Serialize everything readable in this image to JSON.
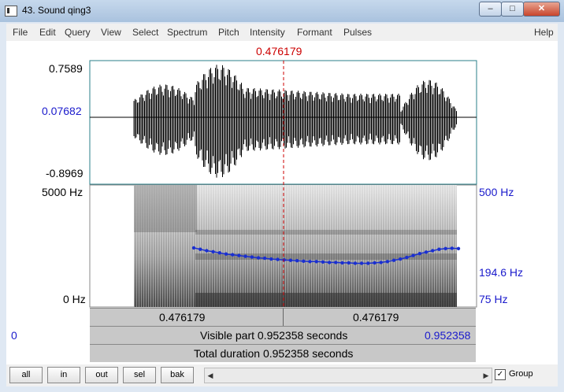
{
  "window": {
    "title": "43. Sound qing3"
  },
  "title_buttons": {
    "minimize": "–",
    "maximize": "□",
    "close": "✕"
  },
  "menu": [
    "File",
    "Edit",
    "Query",
    "View",
    "Select",
    "Spectrum",
    "Pitch",
    "Intensity",
    "Formant",
    "Pulses",
    "Help"
  ],
  "cursor_time": "0.476179",
  "waveform": {
    "max_label": "0.7589",
    "cursor_value": "0.07682",
    "min_label": "-0.8969"
  },
  "spectrogram": {
    "top_freq": "5000 Hz",
    "bottom_freq": "0 Hz",
    "pitch_top": "500 Hz",
    "pitch_value": "194.6 Hz",
    "pitch_bottom": "75 Hz"
  },
  "time_bar": {
    "left": "0.476179",
    "right": "0.476179"
  },
  "visible_bar": {
    "start": "0",
    "text": "Visible part 0.952358 seconds",
    "end": "0.952358"
  },
  "total_bar": {
    "text": "Total duration 0.952358 seconds"
  },
  "buttons": {
    "all": "all",
    "in": "in",
    "out": "out",
    "sel": "sel",
    "bak": "bak"
  },
  "group": {
    "label": "Group",
    "checked": true
  },
  "colors": {
    "cursor": "#cc0000",
    "pitch": "#1a2fd0",
    "label_blue": "#1a1acc"
  },
  "pitch_track_hz": [
    188,
    184,
    180,
    177,
    174,
    171,
    169,
    167,
    165,
    163,
    161,
    160,
    158,
    157,
    156,
    155,
    154,
    153,
    152,
    152,
    151,
    150,
    150,
    149,
    149,
    148,
    148,
    148,
    149,
    150,
    152,
    155,
    158,
    162,
    167,
    172,
    176,
    180,
    184,
    186,
    187,
    186
  ]
}
